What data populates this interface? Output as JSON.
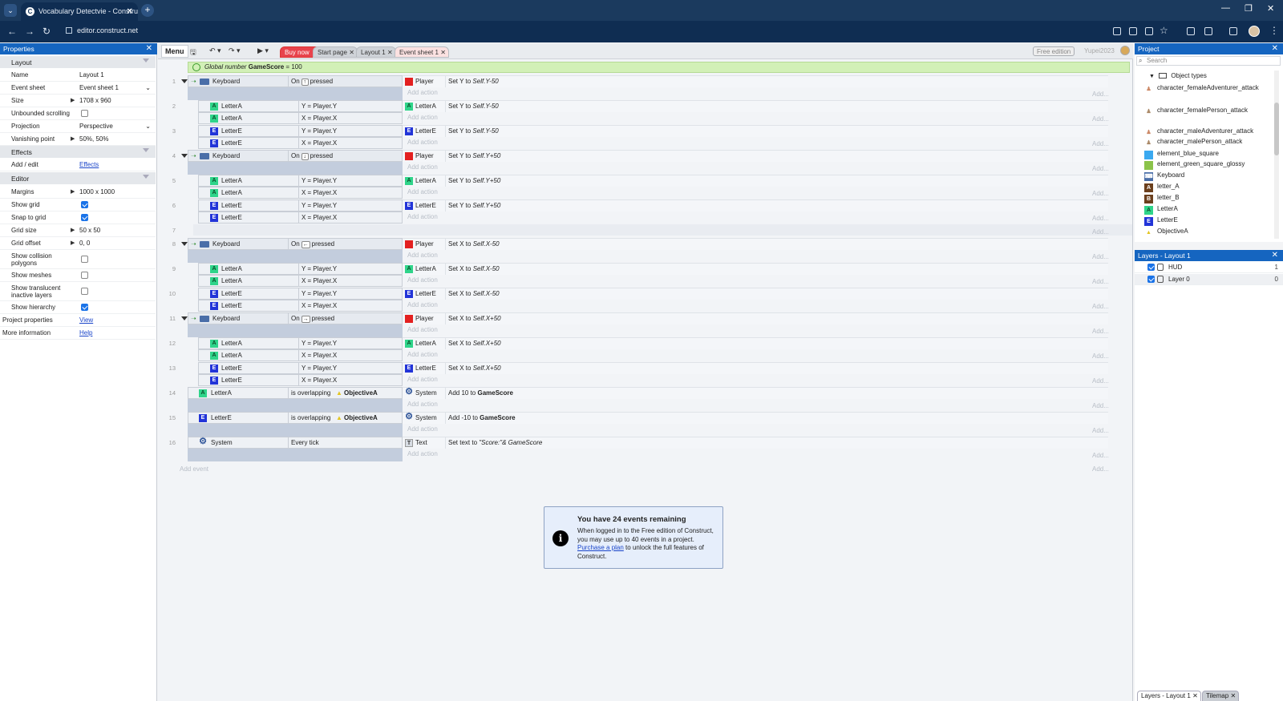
{
  "browser": {
    "tab_title": "Vocabulary Detectvie - Constru",
    "url": "editor.construct.net"
  },
  "properties": {
    "title": "Properties",
    "sections": {
      "layout": "Layout",
      "effects": "Effects",
      "editor": "Editor"
    },
    "rows": {
      "name": {
        "label": "Name",
        "value": "Layout 1"
      },
      "event_sheet": {
        "label": "Event sheet",
        "value": "Event sheet 1"
      },
      "size": {
        "label": "Size",
        "value": "1708 x 960"
      },
      "unbounded": {
        "label": "Unbounded scrolling",
        "checked": false
      },
      "projection": {
        "label": "Projection",
        "value": "Perspective"
      },
      "vanishing": {
        "label": "Vanishing point",
        "value": "50%, 50%"
      },
      "effects_add": {
        "label": "Add / edit",
        "value": "Effects"
      },
      "margins": {
        "label": "Margins",
        "value": "1000 x 1000"
      },
      "show_grid": {
        "label": "Show grid",
        "checked": true
      },
      "snap_grid": {
        "label": "Snap to grid",
        "checked": true
      },
      "grid_size": {
        "label": "Grid size",
        "value": "50 x 50"
      },
      "grid_offset": {
        "label": "Grid offset",
        "value": "0, 0"
      },
      "show_collision": {
        "label1": "Show collision",
        "label2": "polygons",
        "checked": false
      },
      "show_meshes": {
        "label": "Show meshes",
        "checked": false
      },
      "show_translucent": {
        "label1": "Show translucent",
        "label2": "inactive layers",
        "checked": false
      },
      "show_hierarchy": {
        "label": "Show hierarchy",
        "checked": true
      },
      "project_props": {
        "label": "Project properties",
        "value": "View"
      },
      "more_info": {
        "label": "More information",
        "value": "Help"
      }
    }
  },
  "toolbar": {
    "menu": "Menu",
    "tabs": {
      "buy": "Buy now",
      "start": "Start page",
      "layout": "Layout 1",
      "event_sheet": "Event sheet 1"
    },
    "free_edition": "Free edition",
    "user": "Yupei2023"
  },
  "global_var": {
    "prefix": "Global number",
    "name": "GameScore",
    "suffix": "= 100"
  },
  "events": {
    "keyboard": "Keyboard",
    "on": "On",
    "pressed": "pressed",
    "keys": {
      "up": "↑",
      "down": "↓",
      "left": "←",
      "right": "→"
    },
    "player": "Player",
    "letter_a": "LetterA",
    "letter_e": "LetterE",
    "system": "System",
    "text": "Text",
    "y_eq": "Y = Player.Y",
    "x_eq": "X = Player.X",
    "add_action": "Add action",
    "add_right": "Add...",
    "is_overlapping": "is overlapping",
    "objective_a": "ObjectiveA",
    "every_tick": "Every tick",
    "set_y": "Set Y to",
    "set_x": "Set X to",
    "y_minus": "Self.Y-50",
    "y_plus": "Self.Y+50",
    "x_minus": "Self.X-50",
    "x_plus": "Self.X+50",
    "add10": "Add 10 to",
    "add_neg10": "Add -10 to",
    "gamescore": "GameScore",
    "set_text": "Set text to",
    "text_expr": "\"Score:\"& GameScore",
    "add_event": "Add event",
    "numbers": [
      "1",
      "2",
      "3",
      "4",
      "5",
      "6",
      "7",
      "8",
      "9",
      "10",
      "11",
      "12",
      "13",
      "14",
      "15",
      "16"
    ]
  },
  "notice": {
    "title": "You have 24 events remaining",
    "body_1": "When logged in to the Free edition of Construct, you may use up to 40 events in a project.",
    "link": "Purchase a plan",
    "body_2": " to unlock the full features of Construct."
  },
  "project": {
    "title": "Project",
    "search_placeholder": "Search",
    "folder": "Object types",
    "items": [
      "character_femaleAdventurer_attack",
      "character_femalePerson_attack",
      "character_maleAdventurer_attack",
      "character_malePerson_attack",
      "element_blue_square",
      "element_green_square_glossy",
      "Keyboard",
      "letter_A",
      "letter_B",
      "LetterA",
      "LetterE",
      "ObjectiveA"
    ]
  },
  "layers": {
    "title": "Layers - Layout 1",
    "rows": [
      {
        "name": "HUD",
        "num": "1"
      },
      {
        "name": "Layer 0",
        "num": "0"
      }
    ],
    "bottom_tabs": {
      "layers": "Layers - Layout 1",
      "tilemap": "Tilemap"
    }
  },
  "colors": {
    "panel_header": "#1565c0",
    "titlebar": "#1b3a5e",
    "global_var_bg": "#d2f0b7",
    "buy_now": "#e8434c"
  }
}
